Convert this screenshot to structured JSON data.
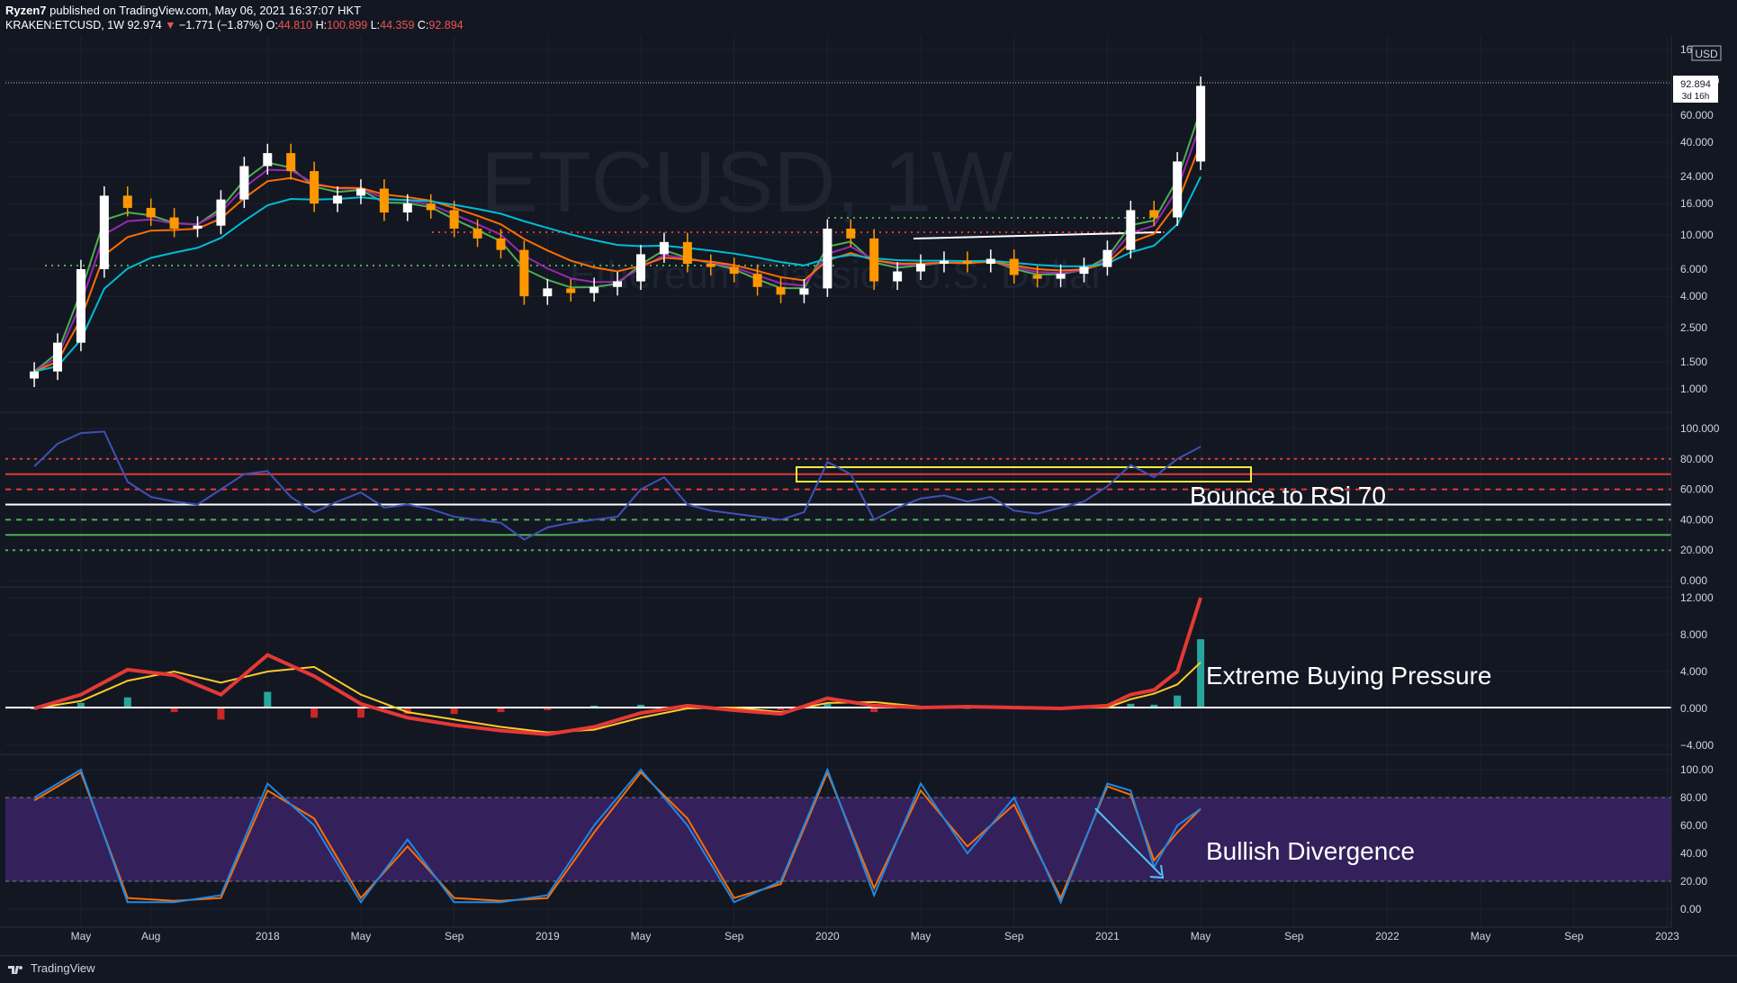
{
  "header": {
    "publisher": "Ryzen7",
    "published_text": "published on TradingView.com, May 06, 2021 16:37:07 HKT",
    "symbol": "KRAKEN:ETCUSD, 1W",
    "price": "92.974",
    "change": "−1.771 (−1.87%)",
    "o_label": "O:",
    "o": "44.810",
    "h_label": "H:",
    "h": "100.899",
    "l_label": "L:",
    "l": "44.359",
    "c_label": "C:",
    "c": "92.894"
  },
  "watermark": {
    "symbol": "ETCUSD, 1W",
    "name": "Ethereum Classic / U.S. Dollar"
  },
  "price_axis": {
    "currency": "USD",
    "last_price": "92.894",
    "countdown": "3d 16h"
  },
  "annotations": {
    "rsi": "Bounce to RSi 70",
    "macd": "Extreme Buying Pressure",
    "stoch": "Bullish Divergence"
  },
  "footer": {
    "brand": "TradingView"
  },
  "colors": {
    "background": "#131722",
    "up": "#ffffff",
    "down": "#ff9800",
    "ema_fast": "#4caf50",
    "ema_mid": "#9c27b0",
    "ema_slow": "#ff6d00",
    "ema_long": "#00bcd4",
    "rsi_line": "#3f51b5",
    "stoch_k": "#1e88e5",
    "stoch_d": "#ff6d00",
    "stoch_band": "#4a2a7a"
  },
  "chart_data": [
    {
      "type": "candlestick",
      "title": "KRAKEN:ETCUSD, 1W",
      "scale": "log",
      "ylim": [
        0.9,
        160
      ],
      "y_ticks": [
        160,
        100,
        60,
        40,
        24,
        16,
        10,
        6,
        4,
        2.5,
        1.5,
        1
      ],
      "y_tick_labels": [
        "160.000",
        "100.000",
        "60.000",
        "40.000",
        "24.000",
        "16.000",
        "10.000",
        "6.000",
        "4.000",
        "2.500",
        "1.500",
        "1.000"
      ],
      "x_tick_labels": [
        "May",
        "Aug",
        "2018",
        "May",
        "Sep",
        "2019",
        "May",
        "Sep",
        "2020",
        "May",
        "Sep",
        "2021",
        "May",
        "Sep",
        "2022",
        "May",
        "Sep",
        "2023"
      ],
      "x_ticks": [
        "2017-05",
        "2017-08",
        "2018-01",
        "2018-05",
        "2018-09",
        "2019-01",
        "2019-05",
        "2019-09",
        "2020-01",
        "2020-05",
        "2020-09",
        "2021-01",
        "2021-05",
        "2021-09",
        "2022-01",
        "2022-05",
        "2022-09",
        "2023-01"
      ],
      "series": [
        {
          "name": "close",
          "x": [
            "2017-03",
            "2017-04",
            "2017-05",
            "2017-06",
            "2017-07",
            "2017-08",
            "2017-09",
            "2017-10",
            "2017-11",
            "2017-12",
            "2018-01",
            "2018-02",
            "2018-03",
            "2018-04",
            "2018-05",
            "2018-06",
            "2018-07",
            "2018-08",
            "2018-09",
            "2018-10",
            "2018-11",
            "2018-12",
            "2019-01",
            "2019-02",
            "2019-03",
            "2019-04",
            "2019-05",
            "2019-06",
            "2019-07",
            "2019-08",
            "2019-09",
            "2019-10",
            "2019-11",
            "2019-12",
            "2020-01",
            "2020-02",
            "2020-03",
            "2020-04",
            "2020-05",
            "2020-06",
            "2020-07",
            "2020-08",
            "2020-09",
            "2020-10",
            "2020-11",
            "2020-12",
            "2021-01",
            "2021-02",
            "2021-03",
            "2021-04",
            "2021-05"
          ],
          "values": [
            1.3,
            2.0,
            6.0,
            18.0,
            15.0,
            13.0,
            11.0,
            11.5,
            17.0,
            28.0,
            34.0,
            26.0,
            16.0,
            18.0,
            20.0,
            14.0,
            16.0,
            14.5,
            11.0,
            9.5,
            8.0,
            4.0,
            4.5,
            4.2,
            4.6,
            5.0,
            7.5,
            9.0,
            6.5,
            6.2,
            5.6,
            4.6,
            4.1,
            4.5,
            11.0,
            9.5,
            5.0,
            5.8,
            6.5,
            6.8,
            6.5,
            7.0,
            5.5,
            5.2,
            5.6,
            6.2,
            8.0,
            14.5,
            13.0,
            30.0,
            92.894
          ]
        }
      ],
      "last_price": 92.894
    },
    {
      "type": "line",
      "title": "RSI",
      "ylim": [
        0,
        100
      ],
      "y_ticks": [
        0,
        20,
        40,
        60,
        80,
        100
      ],
      "y_tick_labels": [
        "0.000",
        "20.000",
        "40.000",
        "60.000",
        "80.000",
        "100.000"
      ],
      "levels": [
        20,
        30,
        40,
        50,
        60,
        70,
        80
      ],
      "series": [
        {
          "name": "RSI",
          "x": [
            "2017-03",
            "2017-04",
            "2017-05",
            "2017-06",
            "2017-07",
            "2017-08",
            "2017-09",
            "2017-10",
            "2017-11",
            "2017-12",
            "2018-01",
            "2018-02",
            "2018-03",
            "2018-04",
            "2018-05",
            "2018-06",
            "2018-07",
            "2018-08",
            "2018-09",
            "2018-10",
            "2018-11",
            "2018-12",
            "2019-01",
            "2019-02",
            "2019-03",
            "2019-04",
            "2019-05",
            "2019-06",
            "2019-07",
            "2019-08",
            "2019-09",
            "2019-10",
            "2019-11",
            "2019-12",
            "2020-01",
            "2020-02",
            "2020-03",
            "2020-04",
            "2020-05",
            "2020-06",
            "2020-07",
            "2020-08",
            "2020-09",
            "2020-10",
            "2020-11",
            "2020-12",
            "2021-01",
            "2021-02",
            "2021-03",
            "2021-04",
            "2021-05"
          ],
          "values": [
            75,
            90,
            97,
            98,
            65,
            55,
            52,
            50,
            60,
            70,
            72,
            55,
            45,
            52,
            58,
            48,
            50,
            47,
            42,
            40,
            38,
            27,
            35,
            38,
            40,
            42,
            60,
            68,
            50,
            46,
            44,
            42,
            40,
            45,
            78,
            70,
            40,
            48,
            54,
            56,
            52,
            55,
            46,
            44,
            48,
            52,
            62,
            76,
            68,
            80,
            88
          ]
        }
      ]
    },
    {
      "type": "bar",
      "title": "MACD",
      "ylim": [
        -4,
        12
      ],
      "y_ticks": [
        -4,
        0,
        4,
        8,
        12
      ],
      "y_tick_labels": [
        "−4.000",
        "0.000",
        "4.000",
        "8.000",
        "12.000"
      ],
      "series": [
        {
          "name": "MACD",
          "x": [
            "2017-03",
            "2017-05",
            "2017-07",
            "2017-09",
            "2017-11",
            "2018-01",
            "2018-03",
            "2018-05",
            "2018-07",
            "2018-09",
            "2018-11",
            "2019-01",
            "2019-03",
            "2019-05",
            "2019-07",
            "2019-09",
            "2019-11",
            "2020-01",
            "2020-03",
            "2020-05",
            "2020-07",
            "2020-09",
            "2020-11",
            "2021-01",
            "2021-02",
            "2021-03",
            "2021-04",
            "2021-05"
          ],
          "values": [
            0,
            1.5,
            4.2,
            3.6,
            1.5,
            5.8,
            3.5,
            0.5,
            -1.0,
            -1.8,
            -2.4,
            -2.8,
            -2.0,
            -0.5,
            0.3,
            -0.2,
            -0.6,
            1.1,
            0.3,
            0.1,
            0.2,
            0.1,
            0.0,
            0.3,
            1.5,
            2.0,
            4.0,
            12.0
          ]
        },
        {
          "name": "Signal",
          "x": [
            "2017-03",
            "2017-05",
            "2017-07",
            "2017-09",
            "2017-11",
            "2018-01",
            "2018-03",
            "2018-05",
            "2018-07",
            "2018-09",
            "2018-11",
            "2019-01",
            "2019-03",
            "2019-05",
            "2019-07",
            "2019-09",
            "2019-11",
            "2020-01",
            "2020-03",
            "2020-05",
            "2020-07",
            "2020-09",
            "2020-11",
            "2021-01",
            "2021-02",
            "2021-03",
            "2021-04",
            "2021-05"
          ],
          "values": [
            0,
            0.8,
            3.0,
            4.0,
            2.8,
            4.0,
            4.5,
            1.5,
            -0.4,
            -1.2,
            -2.0,
            -2.6,
            -2.3,
            -1.0,
            0.0,
            0.1,
            -0.4,
            0.6,
            0.7,
            0.2,
            0.15,
            0.1,
            0.05,
            0.1,
            1.0,
            1.6,
            2.6,
            5.0
          ]
        },
        {
          "name": "Histogram",
          "x": [
            "2017-03",
            "2017-05",
            "2017-07",
            "2017-09",
            "2017-11",
            "2018-01",
            "2018-03",
            "2018-05",
            "2018-07",
            "2018-09",
            "2018-11",
            "2019-01",
            "2019-03",
            "2019-05",
            "2019-07",
            "2019-09",
            "2019-11",
            "2020-01",
            "2020-03",
            "2020-05",
            "2020-07",
            "2020-09",
            "2020-11",
            "2021-01",
            "2021-02",
            "2021-03",
            "2021-04",
            "2021-05"
          ],
          "values": [
            0,
            0.6,
            1.2,
            -0.4,
            -1.2,
            1.8,
            -1.0,
            -1.0,
            -0.6,
            -0.6,
            -0.4,
            -0.2,
            0.3,
            0.4,
            0.3,
            -0.3,
            -0.2,
            0.5,
            -0.4,
            -0.1,
            0.05,
            0.0,
            -0.05,
            0.2,
            0.5,
            0.4,
            1.4,
            7.5
          ]
        }
      ]
    },
    {
      "type": "line",
      "title": "Stochastic RSI",
      "ylim": [
        0,
        100
      ],
      "y_ticks": [
        0,
        20,
        40,
        60,
        80,
        100
      ],
      "y_tick_labels": [
        "0.00",
        "20.00",
        "40.00",
        "60.00",
        "80.00",
        "100.00"
      ],
      "band": [
        20,
        80
      ],
      "series": [
        {
          "name": "%K",
          "x": [
            "2017-03",
            "2017-05",
            "2017-07",
            "2017-09",
            "2017-11",
            "2018-01",
            "2018-03",
            "2018-05",
            "2018-07",
            "2018-09",
            "2018-11",
            "2019-01",
            "2019-03",
            "2019-05",
            "2019-07",
            "2019-09",
            "2019-11",
            "2020-01",
            "2020-03",
            "2020-05",
            "2020-07",
            "2020-09",
            "2020-11",
            "2021-01",
            "2021-02",
            "2021-03",
            "2021-04",
            "2021-05"
          ],
          "values": [
            80,
            100,
            5,
            5,
            10,
            90,
            60,
            5,
            50,
            5,
            5,
            10,
            60,
            100,
            60,
            5,
            20,
            100,
            10,
            90,
            40,
            80,
            5,
            90,
            85,
            30,
            60,
            72
          ]
        },
        {
          "name": "%D",
          "x": [
            "2017-03",
            "2017-05",
            "2017-07",
            "2017-09",
            "2017-11",
            "2018-01",
            "2018-03",
            "2018-05",
            "2018-07",
            "2018-09",
            "2018-11",
            "2019-01",
            "2019-03",
            "2019-05",
            "2019-07",
            "2019-09",
            "2019-11",
            "2020-01",
            "2020-03",
            "2020-05",
            "2020-07",
            "2020-09",
            "2020-11",
            "2021-01",
            "2021-02",
            "2021-03",
            "2021-04",
            "2021-05"
          ],
          "values": [
            78,
            98,
            8,
            6,
            8,
            85,
            65,
            8,
            45,
            8,
            6,
            8,
            55,
            98,
            65,
            8,
            18,
            98,
            15,
            85,
            45,
            75,
            8,
            88,
            82,
            35,
            55,
            72
          ]
        }
      ]
    }
  ]
}
